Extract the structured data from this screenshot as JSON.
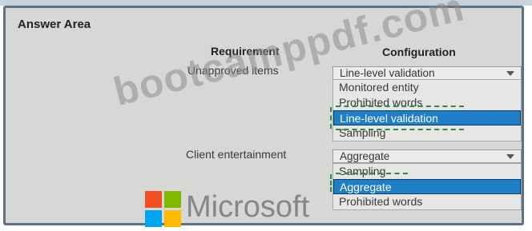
{
  "area_title": "Answer Area",
  "columns": {
    "requirement": "Requirement",
    "configuration": "Configuration"
  },
  "rows": [
    {
      "requirement": "Unapproved items",
      "selected": "Line-level validation",
      "options": [
        "Monitored entity",
        "Prohibited words",
        "Line-level validation",
        "Sampling"
      ],
      "highlighted_option": "Line-level validation"
    },
    {
      "requirement": "Client entertainment",
      "selected": "Aggregate",
      "options": [
        "Sampling",
        "Aggregate",
        "Prohibited words"
      ],
      "highlighted_option": "Aggregate"
    }
  ],
  "watermark": "bootcamppdf.com",
  "brand": {
    "text": "Microsoft",
    "logo_colors": [
      "#f25022",
      "#7fba00",
      "#00a4ef",
      "#ffb900"
    ]
  },
  "colors": {
    "highlight": "#1f7fc6",
    "frame_border": "#5e7286",
    "background": "#d7d7d5"
  }
}
